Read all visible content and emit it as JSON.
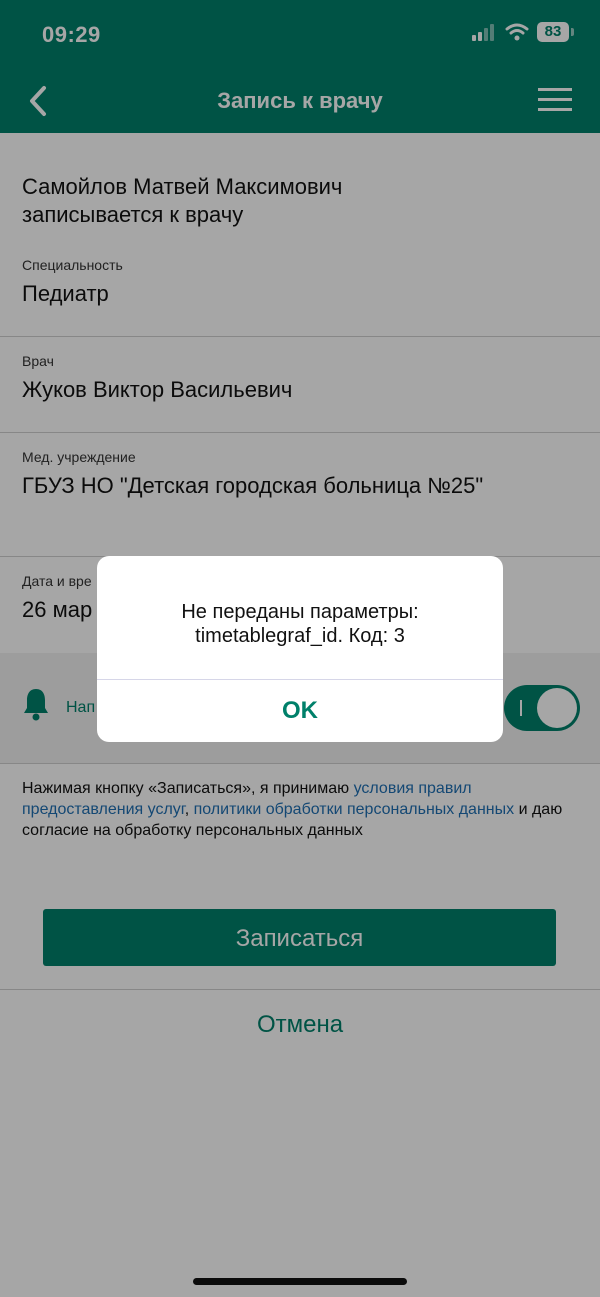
{
  "status_bar": {
    "time": "09:29",
    "battery": "83"
  },
  "nav": {
    "title": "Запись к врачу",
    "back_icon": "chevron-left-icon",
    "menu_icon": "hamburger-menu-icon"
  },
  "patient": {
    "line1": "Самойлов Матвей Максимович",
    "line2": "записывается к врачу"
  },
  "fields": {
    "specialty": {
      "label": "Специальность",
      "value": "Педиатр"
    },
    "doctor": {
      "label": "Врач",
      "value": "Жуков Виктор Васильевич"
    },
    "facility": {
      "label": "Мед. учреждение",
      "value": "ГБУЗ НО \"Детская городская больница №25\""
    },
    "datetime": {
      "label": "Дата и вре",
      "value": "26 мар"
    }
  },
  "notification": {
    "label": "Нап",
    "icon": "bell-icon",
    "toggle_on": true
  },
  "consent": {
    "text1": "Нажимая кнопку «Записаться», я принимаю ",
    "link1": "условия правил предоставления услуг",
    "sep": ", ",
    "link2": "политики обработки персональных данных",
    "text2": " и даю согласие на обработку персональных данных"
  },
  "actions": {
    "submit": "Записаться",
    "cancel": "Отмена"
  },
  "dialog": {
    "line1": "Не переданы параметры:",
    "line2": "timetablegraf_id. Код: 3",
    "ok": "OK"
  },
  "colors": {
    "brand": "#00806a",
    "link": "#1f6fb2"
  }
}
